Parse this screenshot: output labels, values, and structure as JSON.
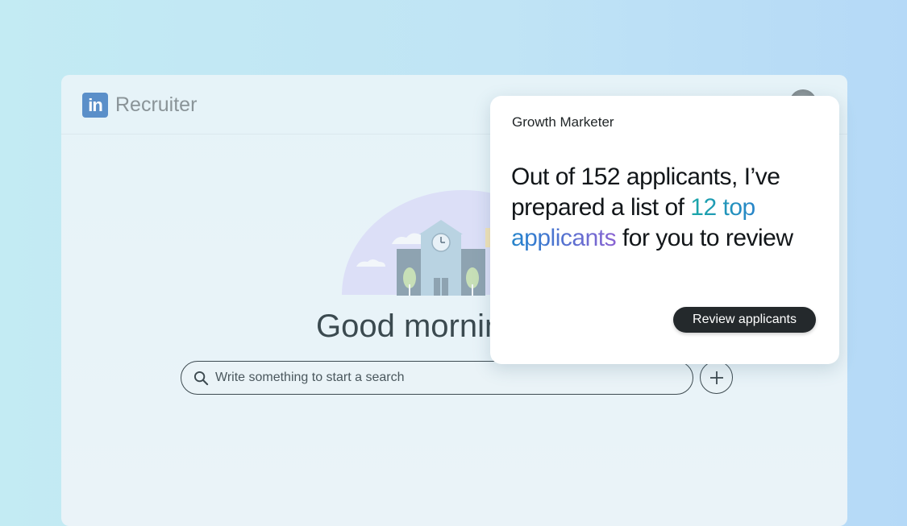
{
  "header": {
    "logo_text": "in",
    "product_name": "Recruiter"
  },
  "main": {
    "greeting": "Good mornin",
    "search": {
      "placeholder": "Write something to start a search",
      "icon": "search-icon"
    },
    "add_icon": "plus-icon"
  },
  "card": {
    "job_title": "Growth Marketer",
    "message_part1": "Out of 152 applicants, I’ve prepared a list of ",
    "message_highlight": "12 top applicants",
    "message_part2": " for you to review",
    "button_label": "Review applicants",
    "highlight_colors": [
      "#1aa8a8",
      "#2b7fcf",
      "#8a63d2"
    ]
  },
  "colors": {
    "logo": "#5a8fc9",
    "button_bg": "#24292c"
  }
}
